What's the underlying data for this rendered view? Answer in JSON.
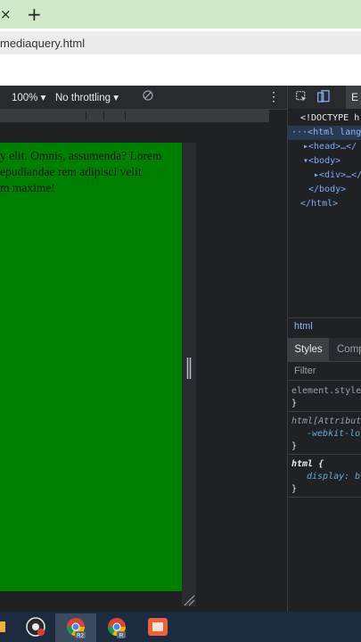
{
  "browser": {
    "tab_close": "×",
    "new_tab": "+",
    "url": "mediaquery.html"
  },
  "devtools_toolbar": {
    "zoom": "100% ▾",
    "throttling": "No throttling ▾",
    "more": "⋮"
  },
  "viewport": {
    "background": "#008000",
    "text_lines": "y elit. Omnis, assumenda? Lorem\nepudiandae rem adipisci velit\nm maxime!"
  },
  "elements_panel": {
    "tab_label": "E",
    "dom_lines": [
      "<!DOCTYPE h",
      "···<html lang=",
      "▸<head>…</",
      "▾<body>",
      "▸<div>…</",
      "</body>",
      "</html>"
    ],
    "breadcrumb": "html"
  },
  "styles_panel": {
    "tabs": [
      "Styles",
      "Comp"
    ],
    "filter_placeholder": "Filter",
    "rules": [
      {
        "selector": "element.style",
        "body": "",
        "end": "}"
      },
      {
        "selector": "html[Attribut",
        "body": "-webkit-lo",
        "end": "}"
      },
      {
        "selector": "html {",
        "body": "display: b",
        "end": "}"
      }
    ]
  },
  "taskbar": {
    "icons": [
      "start-icon",
      "obs-icon",
      "chrome-icon-r2",
      "chrome-icon-r",
      "app-icon"
    ]
  }
}
